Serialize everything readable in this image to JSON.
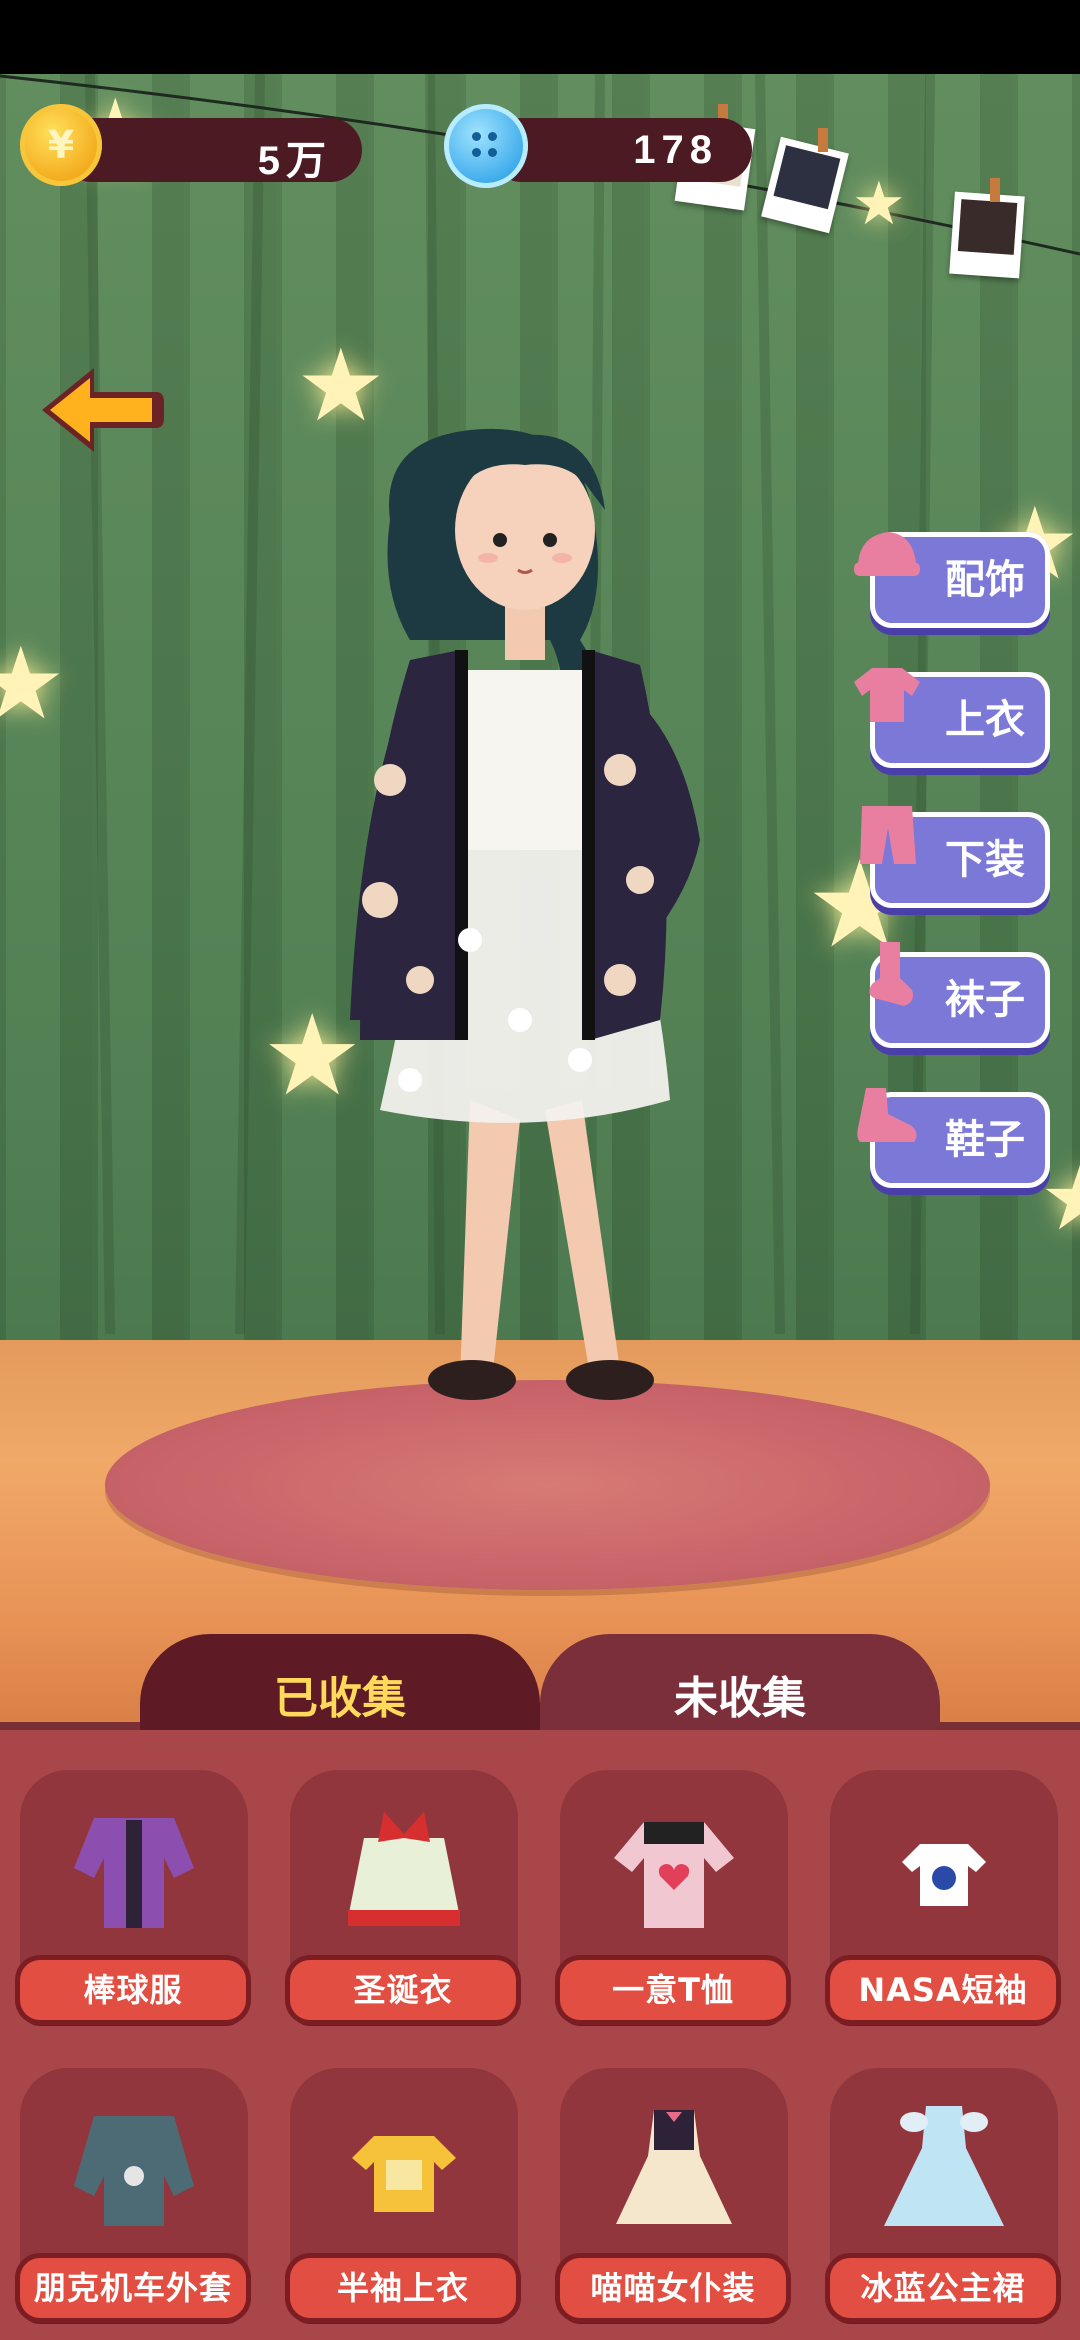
{
  "header": {
    "coins": "5万",
    "coin_glyph": "¥",
    "buttons": "178"
  },
  "categories": [
    {
      "label": "配饰",
      "icon": "hat-icon"
    },
    {
      "label": "上衣",
      "icon": "tshirt-icon"
    },
    {
      "label": "下装",
      "icon": "pants-icon"
    },
    {
      "label": "袜子",
      "icon": "sock-icon"
    },
    {
      "label": "鞋子",
      "icon": "shoe-icon"
    }
  ],
  "tabs": {
    "collected": "已收集",
    "uncollected": "未收集",
    "active": "collected"
  },
  "items": [
    {
      "label": "棒球服",
      "icon": "baseball-jacket-icon"
    },
    {
      "label": "圣诞衣",
      "icon": "christmas-outfit-icon"
    },
    {
      "label": "一意T恤",
      "icon": "heart-tshirt-icon"
    },
    {
      "label": "NASA短袖",
      "icon": "nasa-tshirt-icon"
    },
    {
      "label": "朋克机车外套",
      "icon": "punk-jacket-icon"
    },
    {
      "label": "半袖上衣",
      "icon": "peace-tshirt-icon"
    },
    {
      "label": "喵喵女仆装",
      "icon": "maid-dress-icon"
    },
    {
      "label": "冰蓝公主裙",
      "icon": "princess-dress-icon"
    }
  ],
  "colors": {
    "wall": "#4f7e50",
    "panel": "#a9464a",
    "tab_active_text": "#ffd95a",
    "category_button": "#7c78d8",
    "item_label": "#e24e42"
  }
}
